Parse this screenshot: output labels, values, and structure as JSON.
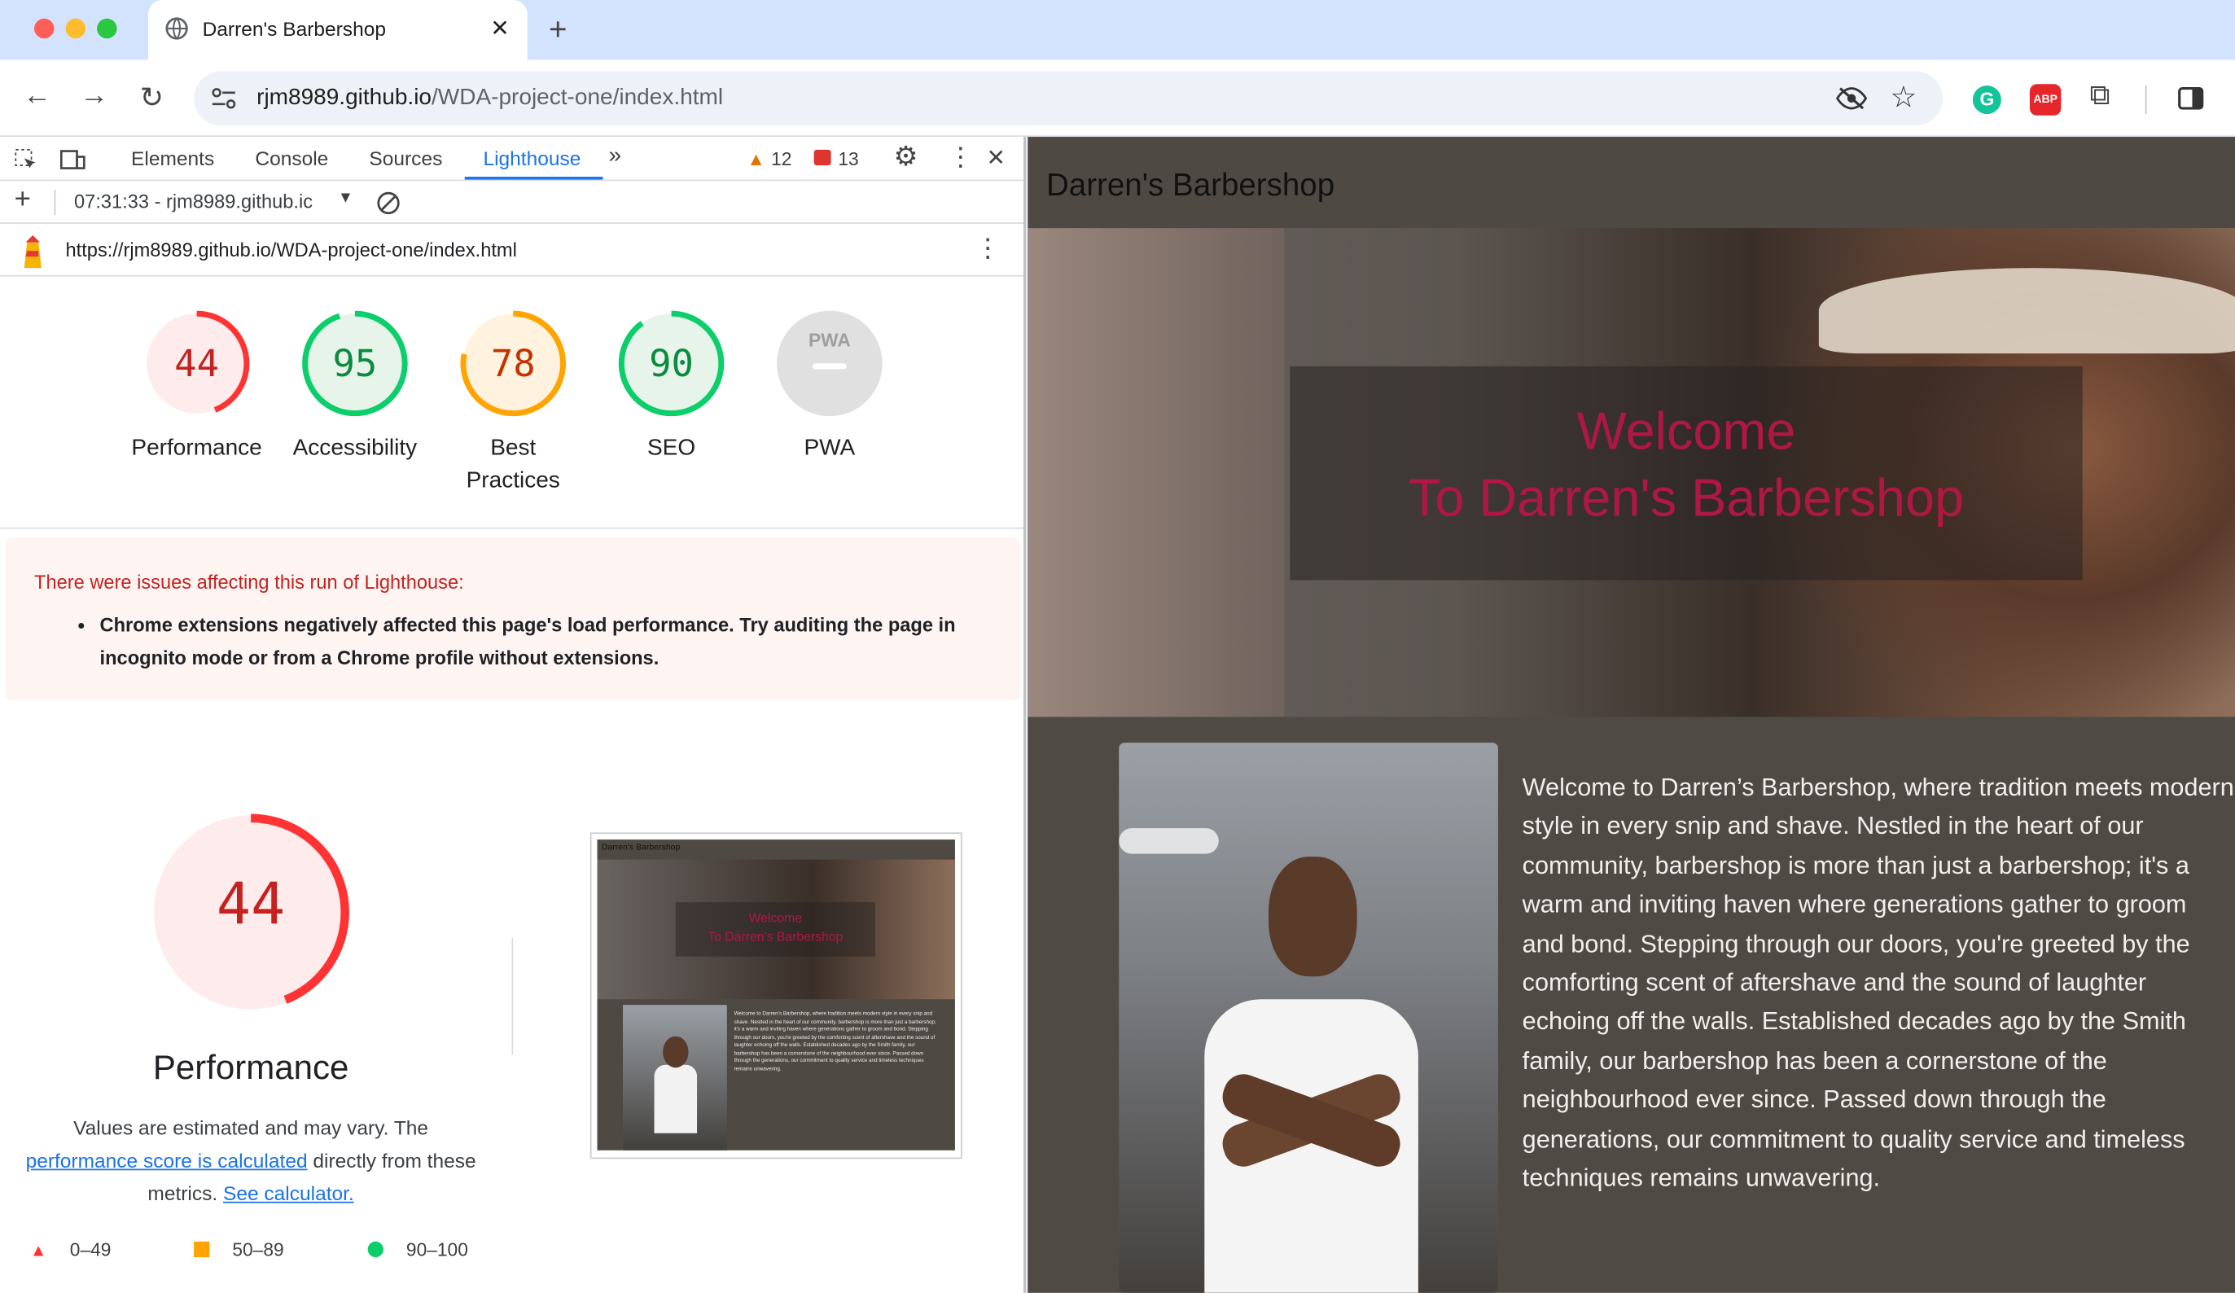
{
  "browser": {
    "tab_title": "Darren's Barbershop",
    "url_host": "rjm8989.github.io",
    "url_path": "/WDA-project-one/index.html"
  },
  "devtools": {
    "tabs": [
      "Elements",
      "Console",
      "Sources",
      "Lighthouse"
    ],
    "warnings": "12",
    "errors": "13",
    "report_select": "07:31:33 - rjm8989.github.ic",
    "report_url": "https://rjm8989.github.io/WDA-project-one/index.html",
    "scores": [
      {
        "label": "Performance",
        "value": "44",
        "color": "#e8341c"
      },
      {
        "label": "Accessibility",
        "value": "95",
        "color": "#0c8a3f"
      },
      {
        "label": "Best Practices",
        "value": "78",
        "color": "#c33300"
      },
      {
        "label": "SEO",
        "value": "90",
        "color": "#0c8a3f"
      },
      {
        "label": "PWA",
        "value": "PWA"
      }
    ],
    "issues_title": "There were issues affecting this run of Lighthouse:",
    "issue": "Chrome extensions negatively affected this page's load performance. Try auditing the page in incognito mode or from a Chrome profile without extensions.",
    "perf_score": "44",
    "perf_title": "Performance",
    "perf_desc_1": "Values are estimated and may vary. The",
    "perf_link": "performance score is calculated",
    "perf_desc_2": "directly from these",
    "perf_desc_3": "metrics.",
    "calc_link": "See calculator.",
    "legend": [
      "0–49",
      "50–89",
      "90–100"
    ],
    "thumb_title": "Darren's Barbershop",
    "thumb_welcome_1": "Welcome",
    "thumb_welcome_2": "To Darren's Barbershop"
  },
  "page": {
    "site_title": "Darren's Barbershop",
    "welcome_1": "Welcome",
    "welcome_2": "To Darren's Barbershop",
    "paragraph": "Welcome to Darren’s Barbershop, where tradition meets modern style in every snip and shave. Nestled in the heart of our community, barbershop is more than just a barbershop; it's a warm and inviting haven where generations gather to groom and bond. Stepping through our doors, you're greeted by the comforting scent of aftershave and the sound of laughter echoing off the walls. Established decades ago by the Smith family, our barbershop has been a cornerstone of the neighbourhood ever since. Passed down through the generations, our commitment to quality service and timeless techniques remains unwavering."
  }
}
